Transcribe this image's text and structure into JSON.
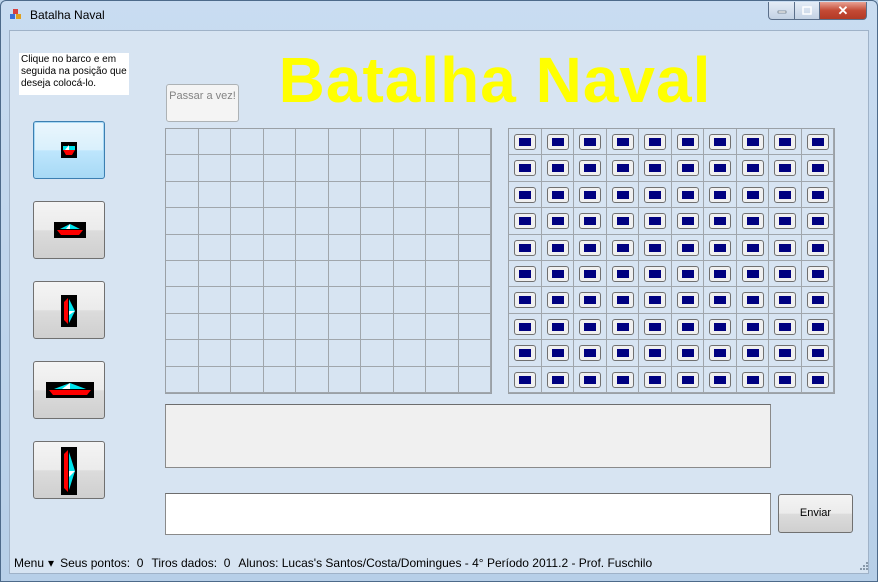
{
  "window": {
    "title": "Batalha Naval",
    "close_label": "✕"
  },
  "instructions": {
    "text": "Clique no barco e em seguida na posição que deseja colocá-lo."
  },
  "header": {
    "title": "Batalha Naval"
  },
  "buttons": {
    "pass_turn": "Passar a vez!",
    "send": "Enviar"
  },
  "chat": {
    "messages": "",
    "input_value": ""
  },
  "status": {
    "menu": "Menu",
    "menu_caret": "▾",
    "points": "Seus pontos:  0",
    "shots": "Tiros dados:  0",
    "credits": "Alunos: Lucas's Santos/Costa/Domingues - 4° Período 2011.2 - Prof. Fuschilo"
  },
  "ships": [
    {
      "name": "ship-size-1",
      "orientation": "horizontal",
      "selected": true
    },
    {
      "name": "ship-size-2-horizontal",
      "orientation": "horizontal",
      "selected": false
    },
    {
      "name": "ship-size-2-vertical",
      "orientation": "vertical",
      "selected": false
    },
    {
      "name": "ship-size-3-horizontal",
      "orientation": "horizontal",
      "selected": false
    },
    {
      "name": "ship-size-3-vertical",
      "orientation": "vertical",
      "selected": false
    }
  ],
  "boards": {
    "rows": 10,
    "cols": 10
  },
  "colors": {
    "title": "#ffff00",
    "cell_fill": "#000080",
    "ship_red": "#ff0000",
    "ship_cyan": "#00e5ee"
  }
}
